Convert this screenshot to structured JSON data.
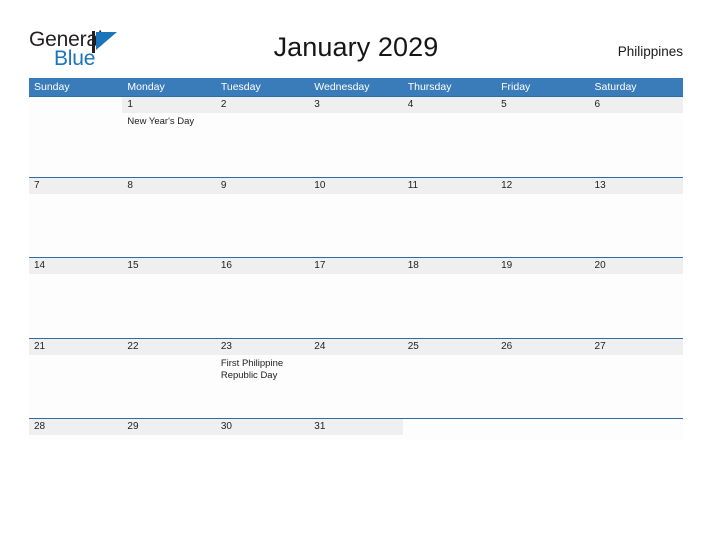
{
  "brand": {
    "name_part1": "General",
    "name_part2": "Blue",
    "flag_color": "#1b75bb"
  },
  "header": {
    "title": "January 2029",
    "region": "Philippines"
  },
  "theme": {
    "header_blue": "#3a7cb9",
    "row_rule": "#2d6ca8",
    "day_band": "#efefef",
    "cell_bg": "#fdfdfd",
    "text": "#1a1a1a"
  },
  "calendar": {
    "weekdays": [
      "Sunday",
      "Monday",
      "Tuesday",
      "Wednesday",
      "Thursday",
      "Friday",
      "Saturday"
    ],
    "weeks": [
      {
        "days": [
          {
            "num": "",
            "events": [],
            "blank": true
          },
          {
            "num": "1",
            "events": [
              "New Year's Day"
            ],
            "blank": false
          },
          {
            "num": "2",
            "events": [],
            "blank": false
          },
          {
            "num": "3",
            "events": [],
            "blank": false
          },
          {
            "num": "4",
            "events": [],
            "blank": false
          },
          {
            "num": "5",
            "events": [],
            "blank": false
          },
          {
            "num": "6",
            "events": [],
            "blank": false
          }
        ]
      },
      {
        "days": [
          {
            "num": "7",
            "events": [],
            "blank": false
          },
          {
            "num": "8",
            "events": [],
            "blank": false
          },
          {
            "num": "9",
            "events": [],
            "blank": false
          },
          {
            "num": "10",
            "events": [],
            "blank": false
          },
          {
            "num": "11",
            "events": [],
            "blank": false
          },
          {
            "num": "12",
            "events": [],
            "blank": false
          },
          {
            "num": "13",
            "events": [],
            "blank": false
          }
        ]
      },
      {
        "days": [
          {
            "num": "14",
            "events": [],
            "blank": false
          },
          {
            "num": "15",
            "events": [],
            "blank": false
          },
          {
            "num": "16",
            "events": [],
            "blank": false
          },
          {
            "num": "17",
            "events": [],
            "blank": false
          },
          {
            "num": "18",
            "events": [],
            "blank": false
          },
          {
            "num": "19",
            "events": [],
            "blank": false
          },
          {
            "num": "20",
            "events": [],
            "blank": false
          }
        ]
      },
      {
        "days": [
          {
            "num": "21",
            "events": [],
            "blank": false
          },
          {
            "num": "22",
            "events": [],
            "blank": false
          },
          {
            "num": "23",
            "events": [
              "First Philippine Republic Day"
            ],
            "blank": false
          },
          {
            "num": "24",
            "events": [],
            "blank": false
          },
          {
            "num": "25",
            "events": [],
            "blank": false
          },
          {
            "num": "26",
            "events": [],
            "blank": false
          },
          {
            "num": "27",
            "events": [],
            "blank": false
          }
        ]
      },
      {
        "days": [
          {
            "num": "28",
            "events": [],
            "blank": false
          },
          {
            "num": "29",
            "events": [],
            "blank": false
          },
          {
            "num": "30",
            "events": [],
            "blank": false
          },
          {
            "num": "31",
            "events": [],
            "blank": false
          },
          {
            "num": "",
            "events": [],
            "blank": true
          },
          {
            "num": "",
            "events": [],
            "blank": true
          },
          {
            "num": "",
            "events": [],
            "blank": true
          }
        ]
      }
    ]
  }
}
